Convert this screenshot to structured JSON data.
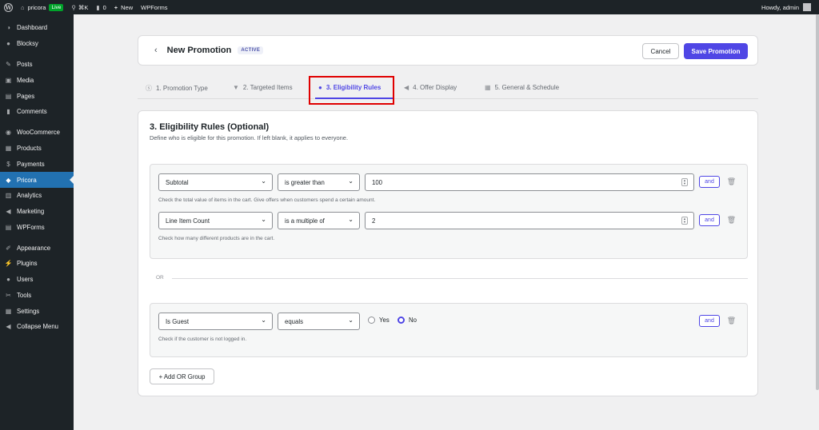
{
  "adminbar": {
    "site_name": "pricora",
    "live_badge": "Live",
    "shortcut": "⌘K",
    "comments_count": "0",
    "new_label": "New",
    "wpforms_label": "WPForms",
    "greeting": "Howdy, admin"
  },
  "sidebar": {
    "items": [
      {
        "label": "Dashboard",
        "icon": "dashboard-icon"
      },
      {
        "label": "Blocksy",
        "icon": "blocksy-icon"
      },
      {
        "label": "Posts",
        "icon": "pin-icon"
      },
      {
        "label": "Media",
        "icon": "media-icon"
      },
      {
        "label": "Pages",
        "icon": "page-icon"
      },
      {
        "label": "Comments",
        "icon": "comment-icon"
      },
      {
        "label": "WooCommerce",
        "icon": "woo-icon"
      },
      {
        "label": "Products",
        "icon": "box-icon"
      },
      {
        "label": "Payments",
        "icon": "dollar-icon"
      },
      {
        "label": "Pricora",
        "icon": "tag-icon"
      },
      {
        "label": "Analytics",
        "icon": "bar-chart-icon"
      },
      {
        "label": "Marketing",
        "icon": "megaphone-icon"
      },
      {
        "label": "WPForms",
        "icon": "forms-icon"
      },
      {
        "label": "Appearance",
        "icon": "brush-icon"
      },
      {
        "label": "Plugins",
        "icon": "plug-icon"
      },
      {
        "label": "Users",
        "icon": "user-icon"
      },
      {
        "label": "Tools",
        "icon": "wrench-icon"
      },
      {
        "label": "Settings",
        "icon": "settings-icon"
      },
      {
        "label": "Collapse Menu",
        "icon": "collapse-icon"
      }
    ],
    "current": "Pricora"
  },
  "header": {
    "title": "New Promotion",
    "status": "ACTIVE",
    "cancel_label": "Cancel",
    "save_label": "Save Promotion"
  },
  "tabs": [
    {
      "label": "1. Promotion Type",
      "icon": "dollar-circle-icon"
    },
    {
      "label": "2. Targeted Items",
      "icon": "funnel-icon"
    },
    {
      "label": "3. Eligibility Rules",
      "icon": "person-icon",
      "active": true
    },
    {
      "label": "4. Offer Display",
      "icon": "megaphone-icon"
    },
    {
      "label": "5. General & Schedule",
      "icon": "calendar-icon"
    }
  ],
  "section": {
    "title": "3. Eligibility Rules (Optional)",
    "description": "Define who is eligible for this promotion. If left blank, it applies to everyone."
  },
  "groups": [
    {
      "rules": [
        {
          "field": "Subtotal",
          "operator": "is greater than",
          "value": "100",
          "and_label": "and",
          "help": "Check the total value of items in the cart. Give offers when customers spend a certain amount."
        },
        {
          "field": "Line Item Count",
          "operator": "is a multiple of",
          "value": "2",
          "and_label": "and",
          "help": "Check how many different products are in the cart."
        }
      ]
    },
    {
      "rules": [
        {
          "field": "Is Guest",
          "operator": "equals",
          "options": [
            "Yes",
            "No"
          ],
          "selected": "No",
          "and_label": "and",
          "help": "Check if the customer is not logged in."
        }
      ]
    }
  ],
  "or_label": "OR",
  "add_or_group_label": "+ Add OR Group",
  "colors": {
    "accent": "#4f46e5",
    "admin_dark": "#1d2327",
    "admin_blue": "#2271b1",
    "highlight": "#e00000"
  }
}
